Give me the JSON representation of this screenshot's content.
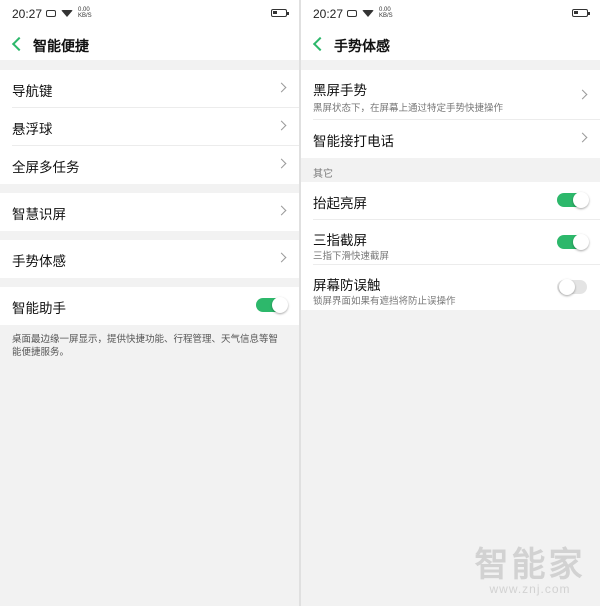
{
  "left": {
    "statusbar": {
      "time": "20:27",
      "speed": "0.00\nKB/S"
    },
    "title": "智能便捷",
    "groups": [
      {
        "items": [
          {
            "label": "导航键"
          },
          {
            "label": "悬浮球"
          },
          {
            "label": "全屏多任务"
          }
        ]
      },
      {
        "items": [
          {
            "label": "智慧识屏"
          }
        ]
      },
      {
        "items": [
          {
            "label": "手势体感"
          }
        ]
      }
    ],
    "assistant": {
      "label": "智能助手",
      "enabled": true
    },
    "footnote": "桌面最边缘一屏显示，提供快捷功能、行程管理、天气信息等智能便捷服务。"
  },
  "right": {
    "statusbar": {
      "time": "20:27",
      "speed": "0.00\nKB/S"
    },
    "title": "手势体感",
    "black_screen": {
      "label": "黑屏手势",
      "sub": "黑屏状态下，在屏幕上通过特定手势快捷操作"
    },
    "smart_call": {
      "label": "智能接打电话"
    },
    "section_other": "其它",
    "toggles": [
      {
        "label": "抬起亮屏",
        "sub": "",
        "enabled": true
      },
      {
        "label": "三指截屏",
        "sub": "三指下滑快速截屏",
        "enabled": true
      },
      {
        "label": "屏幕防误触",
        "sub": "锁屏界面如果有遮挡将防止误操作",
        "enabled": false
      }
    ]
  },
  "watermark": {
    "main": "智能家",
    "sub": "www.znj.com"
  },
  "colors": {
    "accent": "#2db86b",
    "background": "#f2f2f2"
  }
}
